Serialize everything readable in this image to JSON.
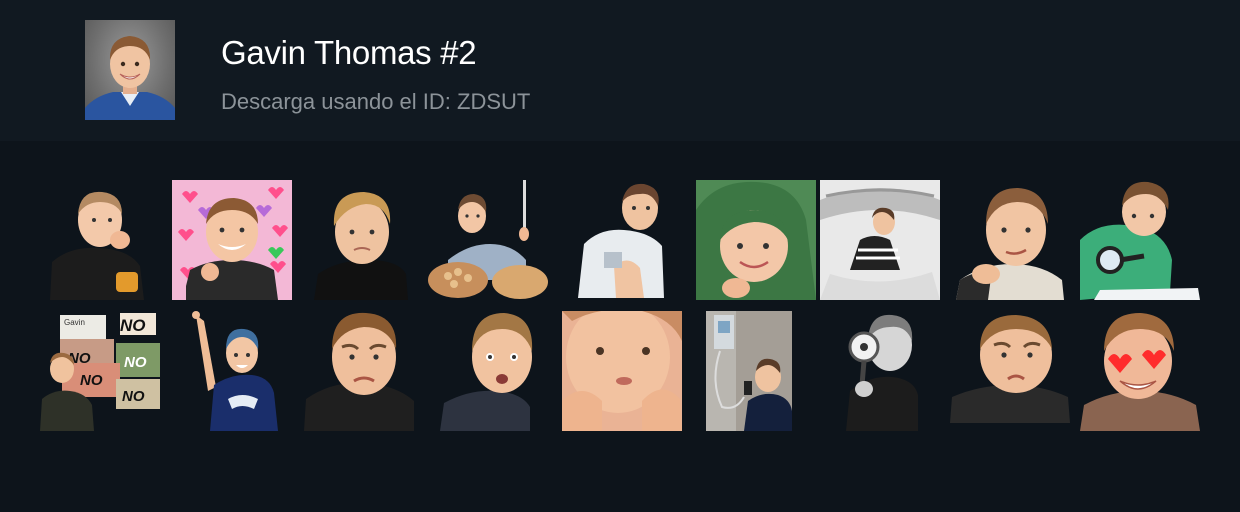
{
  "pack": {
    "title": "Gavin Thomas #2",
    "subtitle": "Descarga usando el ID: ZDSUT",
    "cover_icon": "boy-portrait-icon"
  },
  "colors": {
    "page_background": "#0d141b",
    "header_background": "#111921",
    "title": "#ffffff",
    "subtitle": "#8c9399"
  },
  "stickers": [
    {
      "id": "sticker-1",
      "icon": "boy-eating-icon",
      "caption": ""
    },
    {
      "id": "sticker-2",
      "icon": "boy-hearts-background-icon",
      "caption": ""
    },
    {
      "id": "sticker-3",
      "icon": "boy-skeptical-look-icon",
      "caption": ""
    },
    {
      "id": "sticker-4",
      "icon": "boy-with-fork-icon",
      "caption": ""
    },
    {
      "id": "sticker-5",
      "icon": "boy-sitting-hoodie-icon",
      "caption": ""
    },
    {
      "id": "sticker-6",
      "icon": "boy-green-hood-icon",
      "caption": ""
    },
    {
      "id": "sticker-7",
      "icon": "boy-under-chair-icon",
      "caption": ""
    },
    {
      "id": "sticker-8",
      "icon": "boy-chin-rest-icon",
      "caption": ""
    },
    {
      "id": "sticker-9",
      "icon": "boy-magnifier-reading-icon",
      "caption": ""
    },
    {
      "id": "sticker-10",
      "icon": "boy-no-signs-icon",
      "caption": "NO"
    },
    {
      "id": "sticker-11",
      "icon": "boy-pointing-up-icon",
      "caption": ""
    },
    {
      "id": "sticker-12",
      "icon": "boy-frown-icon",
      "caption": ""
    },
    {
      "id": "sticker-13",
      "icon": "boy-surprised-icon",
      "caption": ""
    },
    {
      "id": "sticker-14",
      "icon": "boy-hands-on-cheeks-icon",
      "caption": ""
    },
    {
      "id": "sticker-15",
      "icon": "boy-payphone-icon",
      "caption": ""
    },
    {
      "id": "sticker-16",
      "icon": "boy-magnifier-bw-icon",
      "caption": ""
    },
    {
      "id": "sticker-17",
      "icon": "boy-pout-icon",
      "caption": ""
    },
    {
      "id": "sticker-18",
      "icon": "boy-heart-eyes-icon",
      "caption": ""
    }
  ],
  "no_sign_label": "NO",
  "no_sign_small": "Gavin"
}
